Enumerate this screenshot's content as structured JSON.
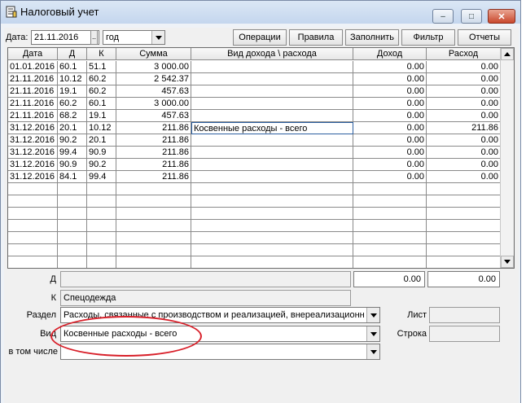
{
  "window": {
    "title": "Налоговый учет",
    "icon": "ledger-app-icon",
    "controls": {
      "minimize": "–",
      "maximize": "□",
      "close": "✕"
    }
  },
  "toolbar": {
    "date_label": "Дата:",
    "date_value": "21.11.2016",
    "picker_label": "..",
    "period_value": "год",
    "buttons": [
      "Операции",
      "Правила",
      "Заполнить",
      "Фильтр",
      "Отчеты"
    ]
  },
  "grid": {
    "columns": [
      "Дата",
      "Д",
      "К",
      "Сумма",
      "Вид дохода \\ расхода",
      "Доход",
      "Расход"
    ],
    "rows": [
      [
        "01.01.2016",
        "60.1",
        "51.1",
        "3 000.00",
        "",
        "0.00",
        "0.00"
      ],
      [
        "21.11.2016",
        "10.12",
        "60.2",
        "2 542.37",
        "",
        "0.00",
        "0.00"
      ],
      [
        "21.11.2016",
        "19.1",
        "60.2",
        "457.63",
        "",
        "0.00",
        "0.00"
      ],
      [
        "21.11.2016",
        "60.2",
        "60.1",
        "3 000.00",
        "",
        "0.00",
        "0.00"
      ],
      [
        "21.11.2016",
        "68.2",
        "19.1",
        "457.63",
        "",
        "0.00",
        "0.00"
      ],
      [
        "31.12.2016",
        "20.1",
        "10.12",
        "211.86",
        "Косвенные расходы - всего",
        "0.00",
        "211.86"
      ],
      [
        "31.12.2016",
        "90.2",
        "20.1",
        "211.86",
        "",
        "0.00",
        "0.00"
      ],
      [
        "31.12.2016",
        "99.4",
        "90.9",
        "211.86",
        "",
        "0.00",
        "0.00"
      ],
      [
        "31.12.2016",
        "90.9",
        "90.2",
        "211.86",
        "",
        "0.00",
        "0.00"
      ],
      [
        "31.12.2016",
        "84.1",
        "99.4",
        "211.86",
        "",
        "0.00",
        "0.00"
      ]
    ],
    "selected_row": 5
  },
  "form": {
    "d_label": "Д",
    "d_value": "",
    "income_value": "0.00",
    "expense_value": "0.00",
    "k_label": "К",
    "k_value": "Спецодежда",
    "section_label": "Раздел",
    "section_value": "Расходы, связанные с производством и реализацией, внереализационн",
    "sheet_label": "Лист",
    "sheet_value": "",
    "kind_label": "Вид",
    "kind_value": "Косвенные расходы - всего",
    "line_label": "Строка",
    "line_value": "",
    "including_label": "в том числе",
    "including_value": ""
  },
  "colors": {
    "annotation": "#d8202a",
    "selection": "#2d5fa0"
  }
}
